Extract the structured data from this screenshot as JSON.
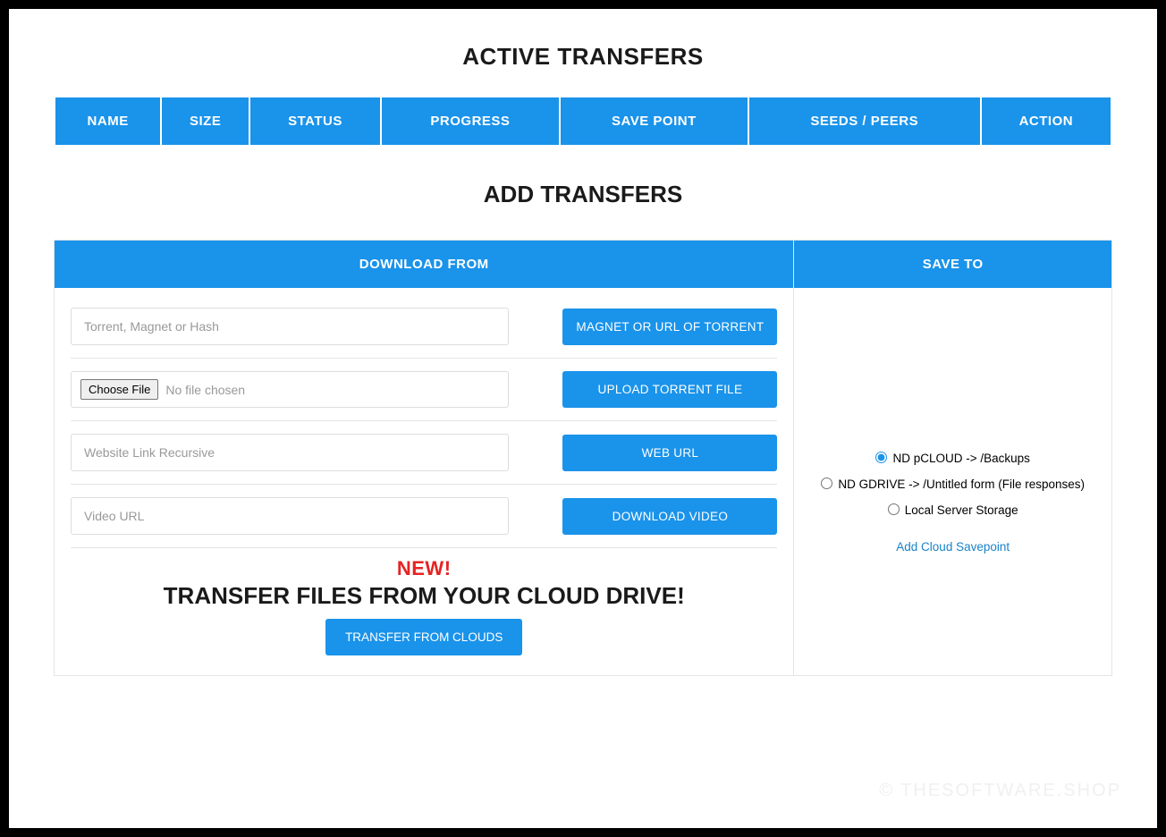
{
  "titles": {
    "active": "ACTIVE TRANSFERS",
    "add": "ADD TRANSFERS"
  },
  "table_headers": [
    "NAME",
    "SIZE",
    "STATUS",
    "PROGRESS",
    "SAVE POINT",
    "SEEDS / PEERS",
    "ACTION"
  ],
  "download_col_header": "DOWNLOAD FROM",
  "save_col_header": "SAVE TO",
  "rows": {
    "torrent_placeholder": "Torrent, Magnet or Hash",
    "torrent_btn": "MAGNET OR URL OF TORRENT",
    "choose_file_btn": "Choose File",
    "no_file_chosen": "No file chosen",
    "upload_btn": "UPLOAD TORRENT FILE",
    "weburl_placeholder": "Website Link Recursive",
    "weburl_btn": "WEB URL",
    "video_placeholder": "Video URL",
    "video_btn": "DOWNLOAD VIDEO"
  },
  "transfer_cloud": {
    "new_label": "NEW!",
    "title": "TRANSFER FILES FROM YOUR CLOUD DRIVE!",
    "btn": "TRANSFER FROM CLOUDS"
  },
  "save_to": {
    "options": [
      "ND pCLOUD -> /Backups",
      "ND GDRIVE -> /Untitled form (File responses)",
      "Local Server Storage"
    ],
    "selected_index": 0,
    "add_link": "Add Cloud Savepoint"
  },
  "watermark": "© THESOFTWARE.SHOP"
}
